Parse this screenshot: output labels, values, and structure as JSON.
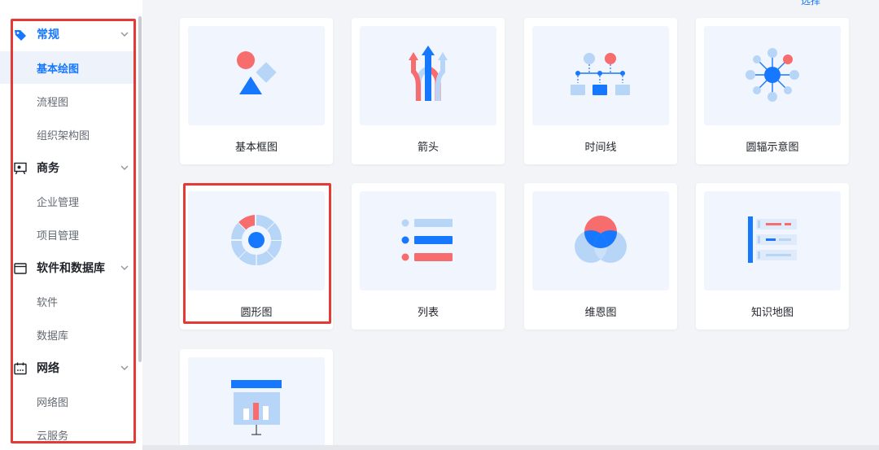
{
  "top_link": "选择",
  "sidebar": {
    "categories": [
      {
        "label": "常规",
        "icon": "tag-icon",
        "subs": [
          "基本绘图",
          "流程图",
          "组织架构图"
        ]
      },
      {
        "label": "商务",
        "icon": "presentation-board-icon",
        "subs": [
          "企业管理",
          "项目管理"
        ]
      },
      {
        "label": "软件和数据库",
        "icon": "window-icon",
        "subs": [
          "软件",
          "数据库"
        ]
      },
      {
        "label": "网络",
        "icon": "calendar-icon",
        "subs": [
          "网络图",
          "云服务"
        ]
      }
    ],
    "active_sub": "基本绘图"
  },
  "cards": [
    {
      "label": "基本框图",
      "icon": "basic-shapes-icon"
    },
    {
      "label": "箭头",
      "icon": "arrows-icon"
    },
    {
      "label": "时间线",
      "icon": "timeline-icon"
    },
    {
      "label": "圆辐示意图",
      "icon": "radial-diagram-icon"
    },
    {
      "label": "圆形图",
      "icon": "circle-chart-icon"
    },
    {
      "label": "列表",
      "icon": "list-icon"
    },
    {
      "label": "维恩图",
      "icon": "venn-icon"
    },
    {
      "label": "知识地图",
      "icon": "knowledge-map-icon"
    },
    {
      "label": "",
      "icon": "presentation-chart-icon"
    }
  ],
  "colors": {
    "accent": "#1677ff",
    "light_blue": "#b7d6f7",
    "coral": "#f76c6c",
    "highlight": "#e53935"
  }
}
